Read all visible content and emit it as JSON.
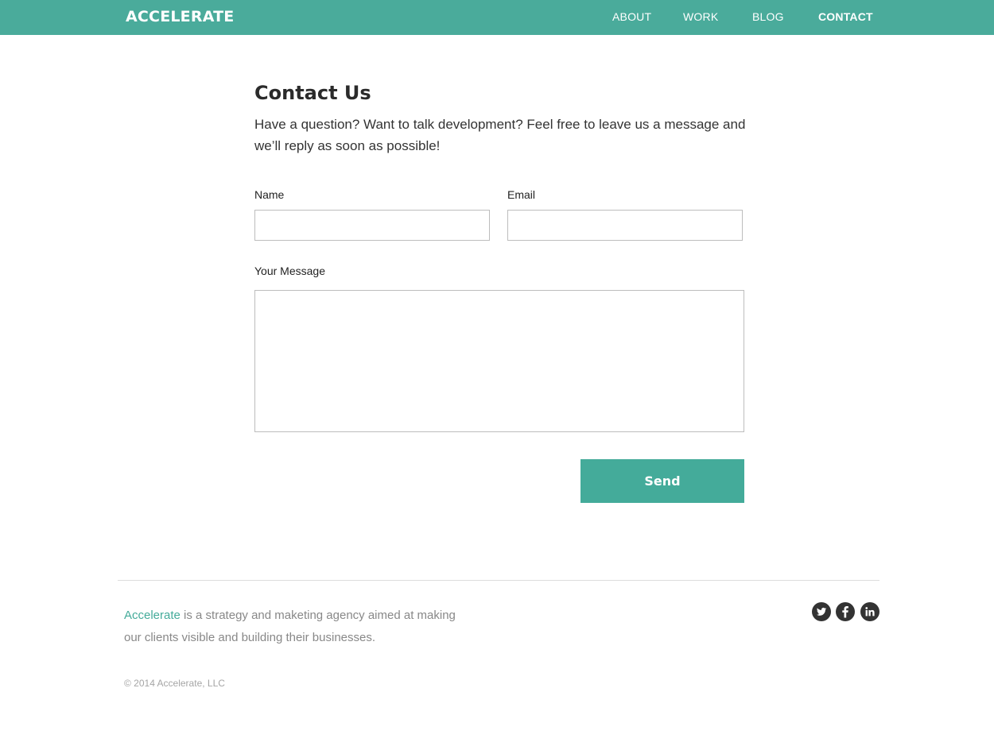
{
  "header": {
    "logo": "ACCELERATE",
    "nav": [
      {
        "label": "ABOUT",
        "active": false
      },
      {
        "label": "WORK",
        "active": false
      },
      {
        "label": "BLOG",
        "active": false
      },
      {
        "label": "CONTACT",
        "active": true
      }
    ]
  },
  "main": {
    "title": "Contact Us",
    "intro": "Have a question? Want to talk development? Feel free to leave us a message and we’ll reply as soon as possible!",
    "form": {
      "name_label": "Name",
      "name_value": "",
      "email_label": "Email",
      "email_value": "",
      "message_label": "Your Message",
      "message_value": "",
      "send_label": "Send"
    }
  },
  "footer": {
    "brand": "Accelerate",
    "about_rest": " is a strategy and maketing agency aimed at making our clients visible and building their businesses.",
    "copyright": "© 2014 Accelerate, LLC",
    "social": [
      {
        "icon": "twitter-icon"
      },
      {
        "icon": "facebook-icon"
      },
      {
        "icon": "linkedin-icon"
      }
    ]
  },
  "colors": {
    "brand": "#4aab9b",
    "button": "#44ab9a",
    "text": "#333333",
    "muted": "#888888",
    "icon": "#333333"
  }
}
